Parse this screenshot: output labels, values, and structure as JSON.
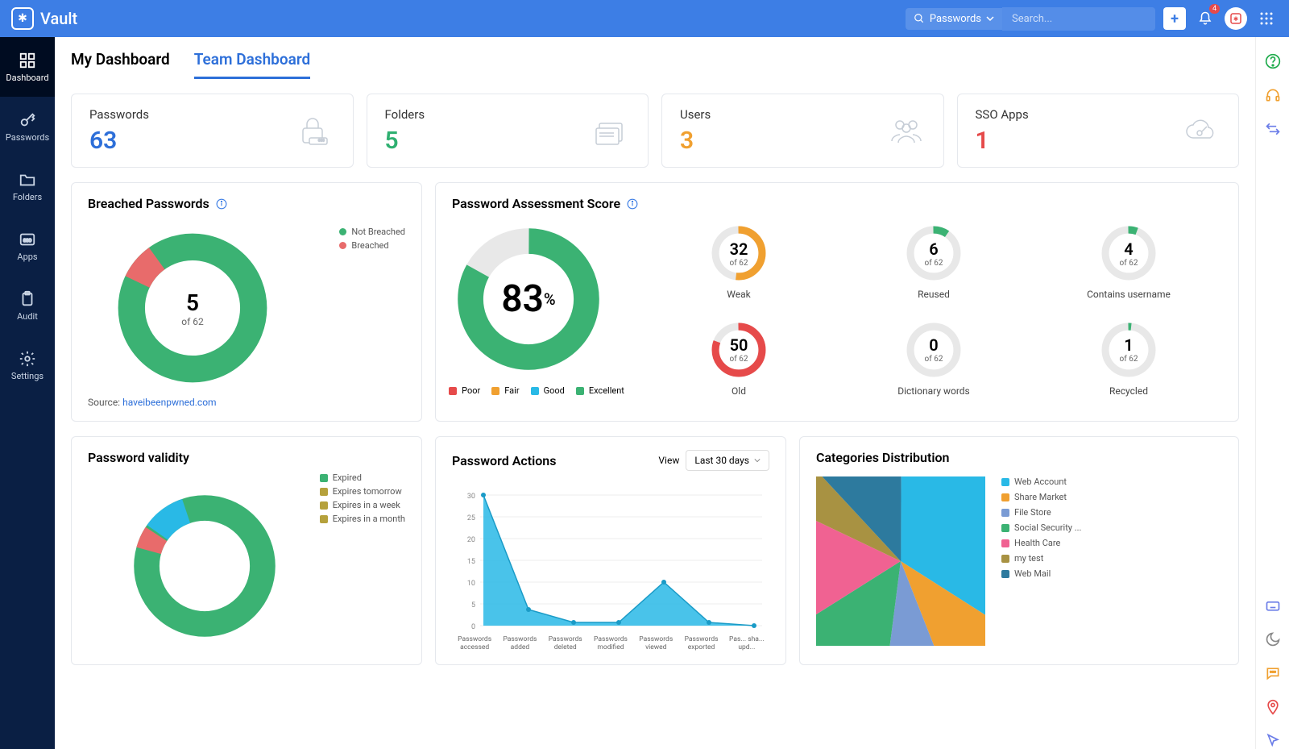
{
  "app": {
    "name": "Vault"
  },
  "topbar": {
    "search_category": "Passwords",
    "search_placeholder": "Search...",
    "notif_count": "4"
  },
  "sidebar": {
    "items": [
      {
        "label": "Dashboard"
      },
      {
        "label": "Passwords"
      },
      {
        "label": "Folders"
      },
      {
        "label": "Apps"
      },
      {
        "label": "Audit"
      },
      {
        "label": "Settings"
      }
    ]
  },
  "tabs": {
    "my": "My Dashboard",
    "team": "Team Dashboard"
  },
  "stats": {
    "passwords": {
      "label": "Passwords",
      "value": "63",
      "color": "#2d6fd9"
    },
    "folders": {
      "label": "Folders",
      "value": "5",
      "color": "#2fb071"
    },
    "users": {
      "label": "Users",
      "value": "3",
      "color": "#f0a030"
    },
    "sso": {
      "label": "SSO Apps",
      "value": "1",
      "color": "#e64a4a"
    }
  },
  "breached": {
    "title": "Breached Passwords",
    "count": "5",
    "total": "of 62",
    "legend": {
      "not": "Not Breached",
      "yes": "Breached"
    },
    "source_label": "Source: ",
    "source_link": "haveibeenpwned.com"
  },
  "assessment": {
    "title": "Password Assessment Score",
    "score": "83",
    "pct": "%",
    "legend": {
      "poor": "Poor",
      "fair": "Fair",
      "good": "Good",
      "excellent": "Excellent"
    },
    "minis": [
      {
        "num": "32",
        "of": "of 62",
        "label": "Weak",
        "color": "#f0a030"
      },
      {
        "num": "6",
        "of": "of 62",
        "label": "Reused",
        "color": "#3bb273"
      },
      {
        "num": "4",
        "of": "of 62",
        "label": "Contains username",
        "color": "#3bb273"
      },
      {
        "num": "50",
        "of": "of 62",
        "label": "Old",
        "color": "#e64a4a"
      },
      {
        "num": "0",
        "of": "of 62",
        "label": "Dictionary words",
        "color": "#3bb273"
      },
      {
        "num": "1",
        "of": "of 62",
        "label": "Recycled",
        "color": "#3bb273"
      }
    ]
  },
  "validity": {
    "title": "Password validity",
    "legend": [
      "Expired",
      "Expires tomorrow",
      "Expires in a week",
      "Expires in a month"
    ]
  },
  "actions": {
    "title": "Password Actions",
    "view_label": "View",
    "range": "Last 30 days",
    "y_ticks": [
      "30",
      "25",
      "20",
      "15",
      "10",
      "5",
      "0"
    ],
    "x_labels": [
      "Passwords accessed",
      "Passwords added",
      "Passwords deleted",
      "Passwords modified",
      "Passwords viewed",
      "Passwords exported",
      "Pas... sha... upd..."
    ]
  },
  "categories": {
    "title": "Categories Distribution",
    "legend": [
      {
        "label": "Web Account",
        "color": "#29b9e6"
      },
      {
        "label": "Share Market",
        "color": "#f0a030"
      },
      {
        "label": "File Store",
        "color": "#7a9bd4"
      },
      {
        "label": "Social Security ...",
        "color": "#3bb273"
      },
      {
        "label": "Health Care",
        "color": "#f06292"
      },
      {
        "label": "my test",
        "color": "#a89242"
      },
      {
        "label": "Web Mail",
        "color": "#2d7a9e"
      }
    ]
  },
  "chart_data": [
    {
      "type": "pie",
      "title": "Breached Passwords",
      "series": [
        {
          "name": "Breached",
          "value": 5
        },
        {
          "name": "Not Breached",
          "value": 57
        }
      ],
      "total_label": "of 62"
    },
    {
      "type": "pie",
      "title": "Password Assessment Score",
      "value_percent": 83,
      "legend": [
        "Poor",
        "Fair",
        "Good",
        "Excellent"
      ],
      "sub_metrics": [
        {
          "name": "Weak",
          "value": 32,
          "total": 62
        },
        {
          "name": "Reused",
          "value": 6,
          "total": 62
        },
        {
          "name": "Contains username",
          "value": 4,
          "total": 62
        },
        {
          "name": "Old",
          "value": 50,
          "total": 62
        },
        {
          "name": "Dictionary words",
          "value": 0,
          "total": 62
        },
        {
          "name": "Recycled",
          "value": 1,
          "total": 62
        }
      ]
    },
    {
      "type": "pie",
      "title": "Password validity",
      "series": [
        {
          "name": "Expired",
          "value": 85
        },
        {
          "name": "Expires tomorrow",
          "value": 0
        },
        {
          "name": "Expires in a week",
          "value": 10
        },
        {
          "name": "Expires in a month",
          "value": 5
        }
      ],
      "note": "percent of total (estimated from arc sizes)"
    },
    {
      "type": "area",
      "title": "Password Actions",
      "range": "Last 30 days",
      "categories": [
        "Passwords accessed",
        "Passwords added",
        "Passwords deleted",
        "Passwords modified",
        "Passwords viewed",
        "Passwords exported",
        "Passwords shared/updated"
      ],
      "values": [
        30,
        4,
        1,
        1,
        10,
        1,
        0
      ],
      "ylim": [
        0,
        30
      ]
    },
    {
      "type": "pie",
      "title": "Categories Distribution",
      "series": [
        {
          "name": "Web Account",
          "value": 34
        },
        {
          "name": "Share Market",
          "value": 10
        },
        {
          "name": "File Store",
          "value": 8
        },
        {
          "name": "Social Security",
          "value": 14
        },
        {
          "name": "Health Care",
          "value": 16
        },
        {
          "name": "my test",
          "value": 6
        },
        {
          "name": "Web Mail",
          "value": 12
        }
      ],
      "note": "percent (estimated from slice angles)"
    }
  ]
}
